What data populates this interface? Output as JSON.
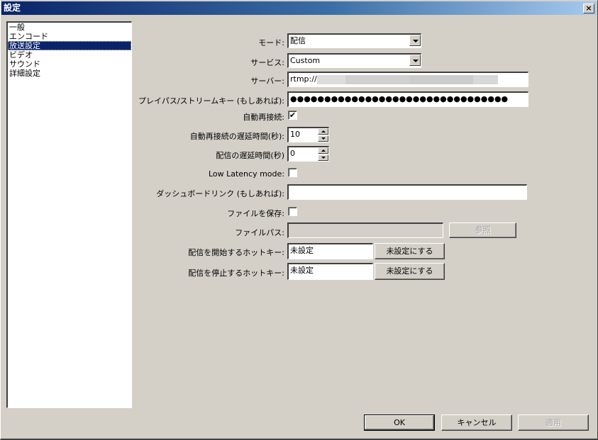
{
  "window": {
    "title": "設定",
    "close_label": "×"
  },
  "sidebar": {
    "items": [
      {
        "label": "一般",
        "selected": false
      },
      {
        "label": "エンコード",
        "selected": false
      },
      {
        "label": "放送設定",
        "selected": true
      },
      {
        "label": "ビデオ",
        "selected": false
      },
      {
        "label": "サウンド",
        "selected": false
      },
      {
        "label": "詳細設定",
        "selected": false
      }
    ]
  },
  "form": {
    "mode": {
      "label": "モード:",
      "value": "配信"
    },
    "service": {
      "label": "サービス:",
      "value": "Custom"
    },
    "server": {
      "label": "サーバー:",
      "value": "rtmp://"
    },
    "stream_key": {
      "label": "プレイパス/ストリームキー (もしあれば):",
      "value": "●●●●●●●●●●●●●●●●●●●●●●●●●●●●●●●●"
    },
    "auto_reconnect": {
      "label": "自動再接続:",
      "checked": true,
      "mark": "✔"
    },
    "reconnect_delay": {
      "label": "自動再接続の遅延時間(秒):",
      "value": "10"
    },
    "stream_delay": {
      "label": "配信の遅延時間(秒)",
      "value": "0"
    },
    "low_latency": {
      "label": "Low Latency mode:",
      "checked": false
    },
    "dashboard_link": {
      "label": "ダッシュボードリンク (もしあれば):",
      "value": ""
    },
    "save_file": {
      "label": "ファイルを保存:",
      "checked": false
    },
    "file_path": {
      "label": "ファイルパス:",
      "value": "",
      "browse_label": "参照"
    },
    "start_hotkey": {
      "label": "配信を開始するホットキー:",
      "value": "未設定",
      "clear_label": "未設定にする"
    },
    "stop_hotkey": {
      "label": "配信を停止するホットキー:",
      "value": "未設定",
      "clear_label": "未設定にする"
    }
  },
  "footer": {
    "ok_label": "OK",
    "cancel_label": "キャンセル",
    "apply_label": "適用"
  }
}
